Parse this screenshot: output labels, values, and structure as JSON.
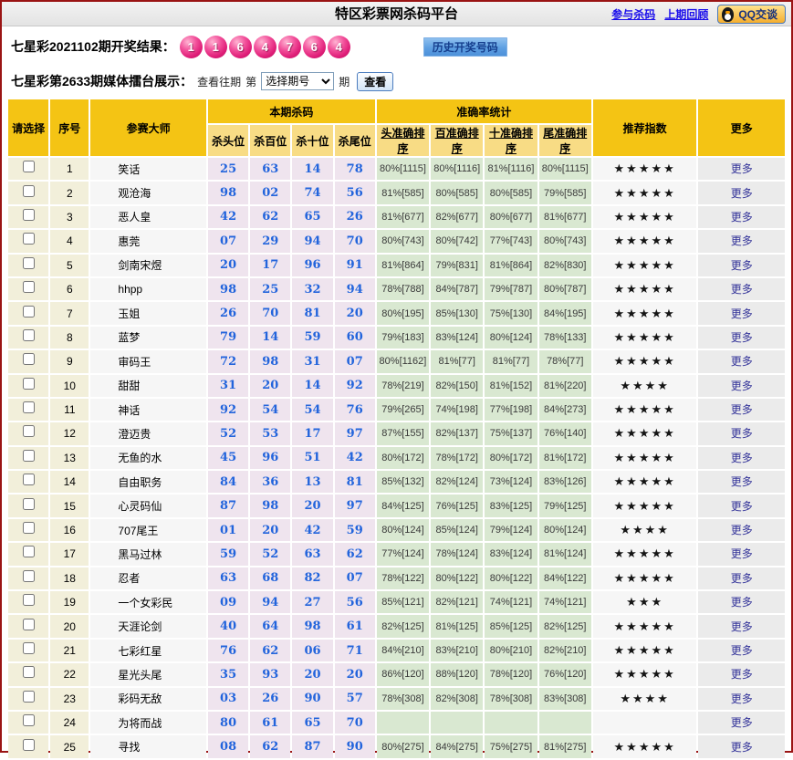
{
  "page": {
    "title": "特区彩票网杀码平台",
    "links": {
      "join": "参与杀码",
      "previous": "上期回顾"
    },
    "qq_button": "QQ交谈"
  },
  "draw": {
    "label": "七星彩2021102期开奖结果：",
    "balls": [
      "1",
      "1",
      "6",
      "4",
      "7",
      "6",
      "4"
    ],
    "history_button": "历史开奖号码"
  },
  "media": {
    "label": "七星彩第2633期媒体擂台展示：",
    "view_past": "查看往期",
    "prefix": "第",
    "select_placeholder": "选择期号",
    "suffix": "期",
    "view_button": "查看"
  },
  "table": {
    "headers": {
      "select": "请选择",
      "index": "序号",
      "master": "参赛大师",
      "kill_group": "本期杀码",
      "kill_cols": [
        "杀头位",
        "杀百位",
        "杀十位",
        "杀尾位"
      ],
      "acc_group": "准确率统计",
      "acc_cols": [
        "头准确排序",
        "百准确排序",
        "十准确排序",
        "尾准确排序"
      ],
      "rating": "推荐指数",
      "more": "更多"
    },
    "more_label": "更多",
    "rows": [
      {
        "index": "1",
        "master": "笑话",
        "kills": [
          "25",
          "63",
          "14",
          "78"
        ],
        "acc": [
          "80%[1115]",
          "80%[1116]",
          "81%[1116]",
          "80%[1115]"
        ],
        "stars": "★★★★★"
      },
      {
        "index": "2",
        "master": "观沧海",
        "kills": [
          "98",
          "02",
          "74",
          "56"
        ],
        "acc": [
          "81%[585]",
          "80%[585]",
          "80%[585]",
          "79%[585]"
        ],
        "stars": "★★★★★"
      },
      {
        "index": "3",
        "master": "恶人皇",
        "kills": [
          "42",
          "62",
          "65",
          "26"
        ],
        "acc": [
          "81%[677]",
          "82%[677]",
          "80%[677]",
          "81%[677]"
        ],
        "stars": "★★★★★"
      },
      {
        "index": "4",
        "master": "惠莞",
        "kills": [
          "07",
          "29",
          "94",
          "70"
        ],
        "acc": [
          "80%[743]",
          "80%[742]",
          "77%[743]",
          "80%[743]"
        ],
        "stars": "★★★★★"
      },
      {
        "index": "5",
        "master": "剑南宋煜",
        "kills": [
          "20",
          "17",
          "96",
          "91"
        ],
        "acc": [
          "81%[864]",
          "79%[831]",
          "81%[864]",
          "82%[830]"
        ],
        "stars": "★★★★★"
      },
      {
        "index": "6",
        "master": "hhpp",
        "kills": [
          "98",
          "25",
          "32",
          "94"
        ],
        "acc": [
          "78%[788]",
          "84%[787]",
          "79%[787]",
          "80%[787]"
        ],
        "stars": "★★★★★"
      },
      {
        "index": "7",
        "master": "玉姐",
        "kills": [
          "26",
          "70",
          "81",
          "20"
        ],
        "acc": [
          "80%[195]",
          "85%[130]",
          "75%[130]",
          "84%[195]"
        ],
        "stars": "★★★★★"
      },
      {
        "index": "8",
        "master": "蓝梦",
        "kills": [
          "79",
          "14",
          "59",
          "60"
        ],
        "acc": [
          "79%[183]",
          "83%[124]",
          "80%[124]",
          "78%[133]"
        ],
        "stars": "★★★★★"
      },
      {
        "index": "9",
        "master": "审码王",
        "kills": [
          "72",
          "98",
          "31",
          "07"
        ],
        "acc": [
          "80%[1162]",
          "81%[77]",
          "81%[77]",
          "78%[77]"
        ],
        "stars": "★★★★★"
      },
      {
        "index": "10",
        "master": "甜甜",
        "kills": [
          "31",
          "20",
          "14",
          "92"
        ],
        "acc": [
          "78%[219]",
          "82%[150]",
          "81%[152]",
          "81%[220]"
        ],
        "stars": "★★★★"
      },
      {
        "index": "11",
        "master": "神话",
        "kills": [
          "92",
          "54",
          "54",
          "76"
        ],
        "acc": [
          "79%[265]",
          "74%[198]",
          "77%[198]",
          "84%[273]"
        ],
        "stars": "★★★★★"
      },
      {
        "index": "12",
        "master": "澄迈贵",
        "kills": [
          "52",
          "53",
          "17",
          "97"
        ],
        "acc": [
          "87%[155]",
          "82%[137]",
          "75%[137]",
          "76%[140]"
        ],
        "stars": "★★★★★"
      },
      {
        "index": "13",
        "master": "无鱼的水",
        "kills": [
          "45",
          "96",
          "51",
          "42"
        ],
        "acc": [
          "80%[172]",
          "78%[172]",
          "80%[172]",
          "81%[172]"
        ],
        "stars": "★★★★★"
      },
      {
        "index": "14",
        "master": "自由职务",
        "kills": [
          "84",
          "36",
          "13",
          "81"
        ],
        "acc": [
          "85%[132]",
          "82%[124]",
          "73%[124]",
          "83%[126]"
        ],
        "stars": "★★★★★"
      },
      {
        "index": "15",
        "master": "心灵码仙",
        "kills": [
          "87",
          "98",
          "20",
          "97"
        ],
        "acc": [
          "84%[125]",
          "76%[125]",
          "83%[125]",
          "79%[125]"
        ],
        "stars": "★★★★★"
      },
      {
        "index": "16",
        "master": "707尾王",
        "kills": [
          "01",
          "20",
          "42",
          "59"
        ],
        "acc": [
          "80%[124]",
          "85%[124]",
          "79%[124]",
          "80%[124]"
        ],
        "stars": "★★★★"
      },
      {
        "index": "17",
        "master": "黑马过林",
        "kills": [
          "59",
          "52",
          "63",
          "62"
        ],
        "acc": [
          "77%[124]",
          "78%[124]",
          "83%[124]",
          "81%[124]"
        ],
        "stars": "★★★★★"
      },
      {
        "index": "18",
        "master": "忍者",
        "kills": [
          "63",
          "68",
          "82",
          "07"
        ],
        "acc": [
          "78%[122]",
          "80%[122]",
          "80%[122]",
          "84%[122]"
        ],
        "stars": "★★★★★"
      },
      {
        "index": "19",
        "master": "一个女彩民",
        "kills": [
          "09",
          "94",
          "27",
          "56"
        ],
        "acc": [
          "85%[121]",
          "82%[121]",
          "74%[121]",
          "74%[121]"
        ],
        "stars": "★★★"
      },
      {
        "index": "20",
        "master": "天涯论剑",
        "kills": [
          "40",
          "64",
          "98",
          "61"
        ],
        "acc": [
          "82%[125]",
          "81%[125]",
          "85%[125]",
          "82%[125]"
        ],
        "stars": "★★★★★"
      },
      {
        "index": "21",
        "master": "七彩红星",
        "kills": [
          "76",
          "62",
          "06",
          "71"
        ],
        "acc": [
          "84%[210]",
          "83%[210]",
          "80%[210]",
          "82%[210]"
        ],
        "stars": "★★★★★"
      },
      {
        "index": "22",
        "master": "星光头尾",
        "kills": [
          "35",
          "93",
          "20",
          "20"
        ],
        "acc": [
          "86%[120]",
          "88%[120]",
          "78%[120]",
          "76%[120]"
        ],
        "stars": "★★★★★"
      },
      {
        "index": "23",
        "master": "彩码无敌",
        "kills": [
          "03",
          "26",
          "90",
          "57"
        ],
        "acc": [
          "78%[308]",
          "82%[308]",
          "78%[308]",
          "83%[308]"
        ],
        "stars": "★★★★"
      },
      {
        "index": "24",
        "master": "为将而战",
        "kills": [
          "80",
          "61",
          "65",
          "70"
        ],
        "acc": [
          "",
          "",
          "",
          ""
        ],
        "stars": ""
      },
      {
        "index": "25",
        "master": "寻找",
        "kills": [
          "08",
          "62",
          "87",
          "90"
        ],
        "acc": [
          "80%[275]",
          "84%[275]",
          "75%[275]",
          "81%[275]"
        ],
        "stars": "★★★★★"
      }
    ]
  },
  "theme": {
    "page_border": "#9A1414",
    "header_gold": "#F4C414",
    "subheader_gold": "#F8DC85",
    "select_cell_bg": "#F2EFDA",
    "kill_cell_bg": "#EFE4EE",
    "acc_cell_bg": "#D9E8D1",
    "kill_number_color": "#2264DC",
    "ball_pink": "#DF1E78",
    "link_blue": "#1A0DEB",
    "more_link_color": "#333399"
  }
}
